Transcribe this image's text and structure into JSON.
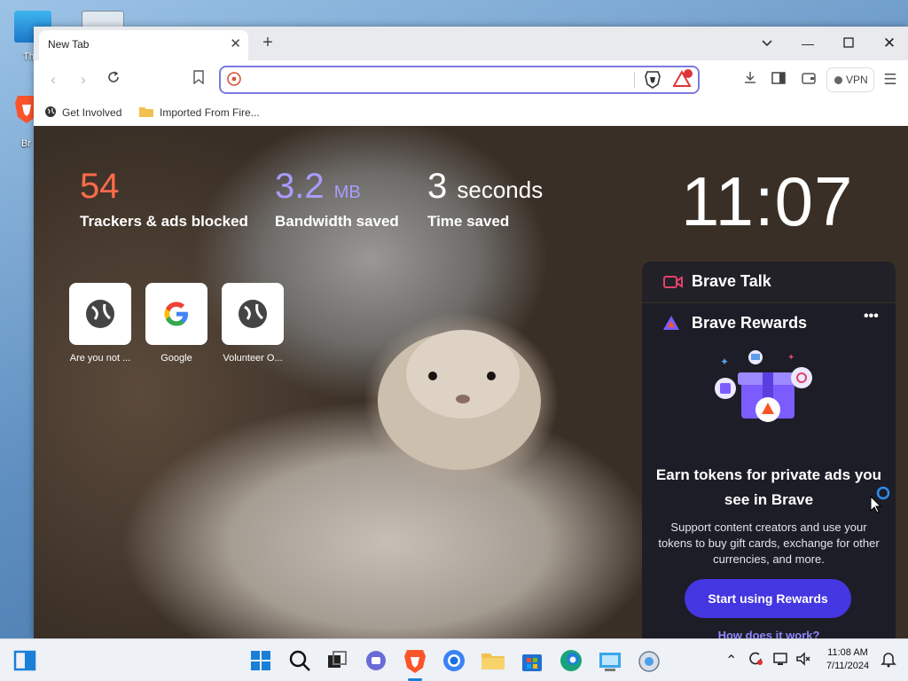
{
  "desktop": {
    "icon1_label": "Th",
    "icon3_label": "Br"
  },
  "browser": {
    "tab_title": "New Tab",
    "address_placeholder": "",
    "vpn_label": "VPN",
    "bookmarks": [
      {
        "label": "Get Involved"
      },
      {
        "label": "Imported From Fire..."
      }
    ]
  },
  "new_tab": {
    "stats": {
      "trackers_value": "54",
      "trackers_label": "Trackers & ads blocked",
      "bandwidth_value": "3.2",
      "bandwidth_unit": "MB",
      "bandwidth_label": "Bandwidth saved",
      "time_value": "3",
      "time_unit": "seconds",
      "time_label": "Time saved"
    },
    "clock": "11:07",
    "top_sites": [
      {
        "label": "Are you not ...",
        "icon": "globe-icon"
      },
      {
        "label": "Google",
        "icon": "google-icon"
      },
      {
        "label": "Volunteer O...",
        "icon": "globe-icon"
      }
    ],
    "brave_talk": {
      "title": "Brave Talk"
    },
    "brave_rewards": {
      "title": "Brave Rewards",
      "menu": "•••",
      "heading": "Earn tokens for private ads you see in Brave",
      "body": "Support content creators and use your tokens to buy gift cards, exchange for other currencies, and more.",
      "button": "Start using Rewards",
      "link": "How does it work?"
    }
  },
  "taskbar": {
    "time": "11:08 AM",
    "date": "7/11/2024"
  },
  "colors": {
    "trackers": "#ff6b4a",
    "bandwidth": "#a89cff",
    "accent": "#4436e0",
    "brave_orange": "#fb542b"
  }
}
